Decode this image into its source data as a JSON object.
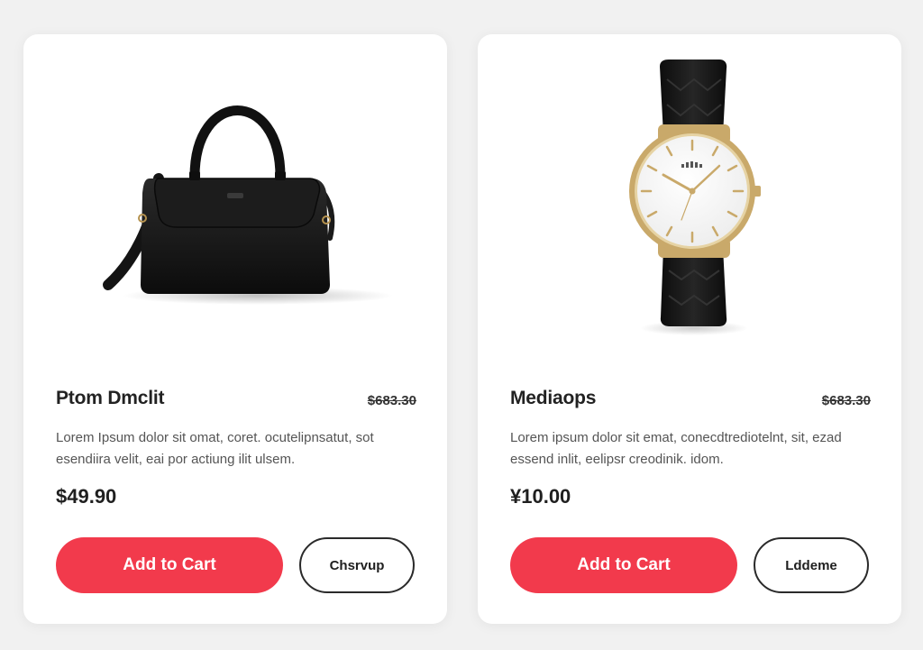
{
  "products": [
    {
      "name": "Ptom Dmclit",
      "original_price": "$683.30",
      "description": "Lorem Ipsum dolor sit omat, coret. ocutelipnsatut, sot esendiira velit, eai por actiung ilit ulsem.",
      "price": "$49.90",
      "primary_button": "Add to Cart",
      "secondary_button": "Chsrvup",
      "image_icon": "handbag-icon"
    },
    {
      "name": "Mediaops",
      "original_price": "$683.30",
      "description": "Lorem ipsum dolor sit emat, conecdtrediotelnt, sit, ezad essend inlit, eelipsr creodinik. idom.",
      "price": "¥10.00",
      "primary_button": "Add to Cart",
      "secondary_button": "Lddeme",
      "image_icon": "wristwatch-icon"
    }
  ],
  "colors": {
    "background": "#f1f1f1",
    "card": "#ffffff",
    "accent": "#f23a4c",
    "text_primary": "#222222",
    "text_secondary": "#555555",
    "watch_gold": "#c9a96a"
  }
}
